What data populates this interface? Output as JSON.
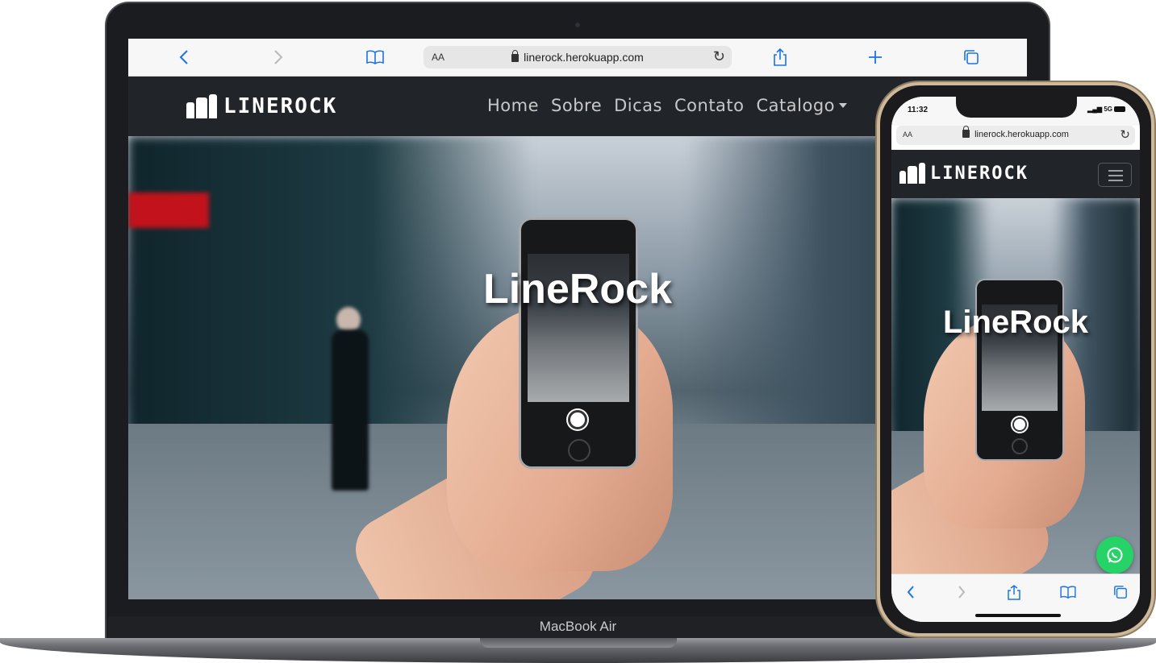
{
  "desktop": {
    "device_label": "MacBook Air",
    "browser": {
      "url": "linerock.herokuapp.com",
      "text_size_label": "AA",
      "icons": [
        "chevron-left-icon",
        "chevron-right-icon",
        "bookmarks-icon",
        "lock-icon",
        "reload-icon",
        "share-icon",
        "plus-icon",
        "tabs-icon"
      ]
    },
    "site": {
      "logo_text": "LINEROCK",
      "nav": [
        {
          "label": "Home"
        },
        {
          "label": "Sobre"
        },
        {
          "label": "Dicas"
        },
        {
          "label": "Contato"
        },
        {
          "label": "Catalogo"
        }
      ],
      "hero_title": "LineRock"
    }
  },
  "mobile": {
    "status": {
      "time": "11:32",
      "network": "5G"
    },
    "browser": {
      "url": "linerock.herokuapp.com",
      "text_size_label": "AA"
    },
    "site": {
      "logo_text": "LINEROCK",
      "menu_icon": "hamburger-menu-icon",
      "hero_title": "LineRock",
      "fab_icon": "whatsapp-icon"
    },
    "toolbar_icons": [
      "chevron-left-icon",
      "chevron-right-icon",
      "share-icon",
      "bookmarks-icon",
      "tabs-icon"
    ]
  },
  "colors": {
    "navbar": "#212529",
    "browser_accent": "#1a73e8",
    "whatsapp": "#25d366"
  }
}
